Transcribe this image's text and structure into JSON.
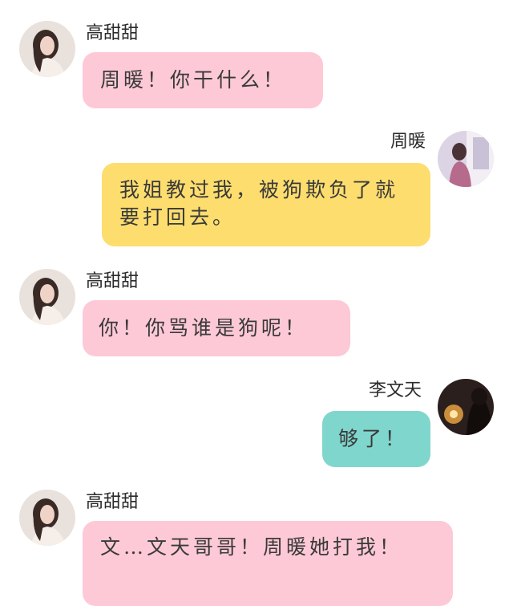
{
  "messages": [
    {
      "speaker": "高甜甜",
      "text": "周暖！你干什么！",
      "color": "#fec9d6",
      "side": "left"
    },
    {
      "speaker": "周暖",
      "text": "我姐教过我，被狗欺负了就要打回去。",
      "color": "#fddd6e",
      "side": "right"
    },
    {
      "speaker": "高甜甜",
      "text": "你！你骂谁是狗呢！",
      "color": "#fec9d6",
      "side": "left"
    },
    {
      "speaker": "李文天",
      "text": "够了！",
      "color": "#7fd6cd",
      "side": "right"
    },
    {
      "speaker": "高甜甜",
      "text": "文…文天哥哥！周暖她打我！",
      "color": "#fec9d6",
      "side": "left"
    }
  ]
}
